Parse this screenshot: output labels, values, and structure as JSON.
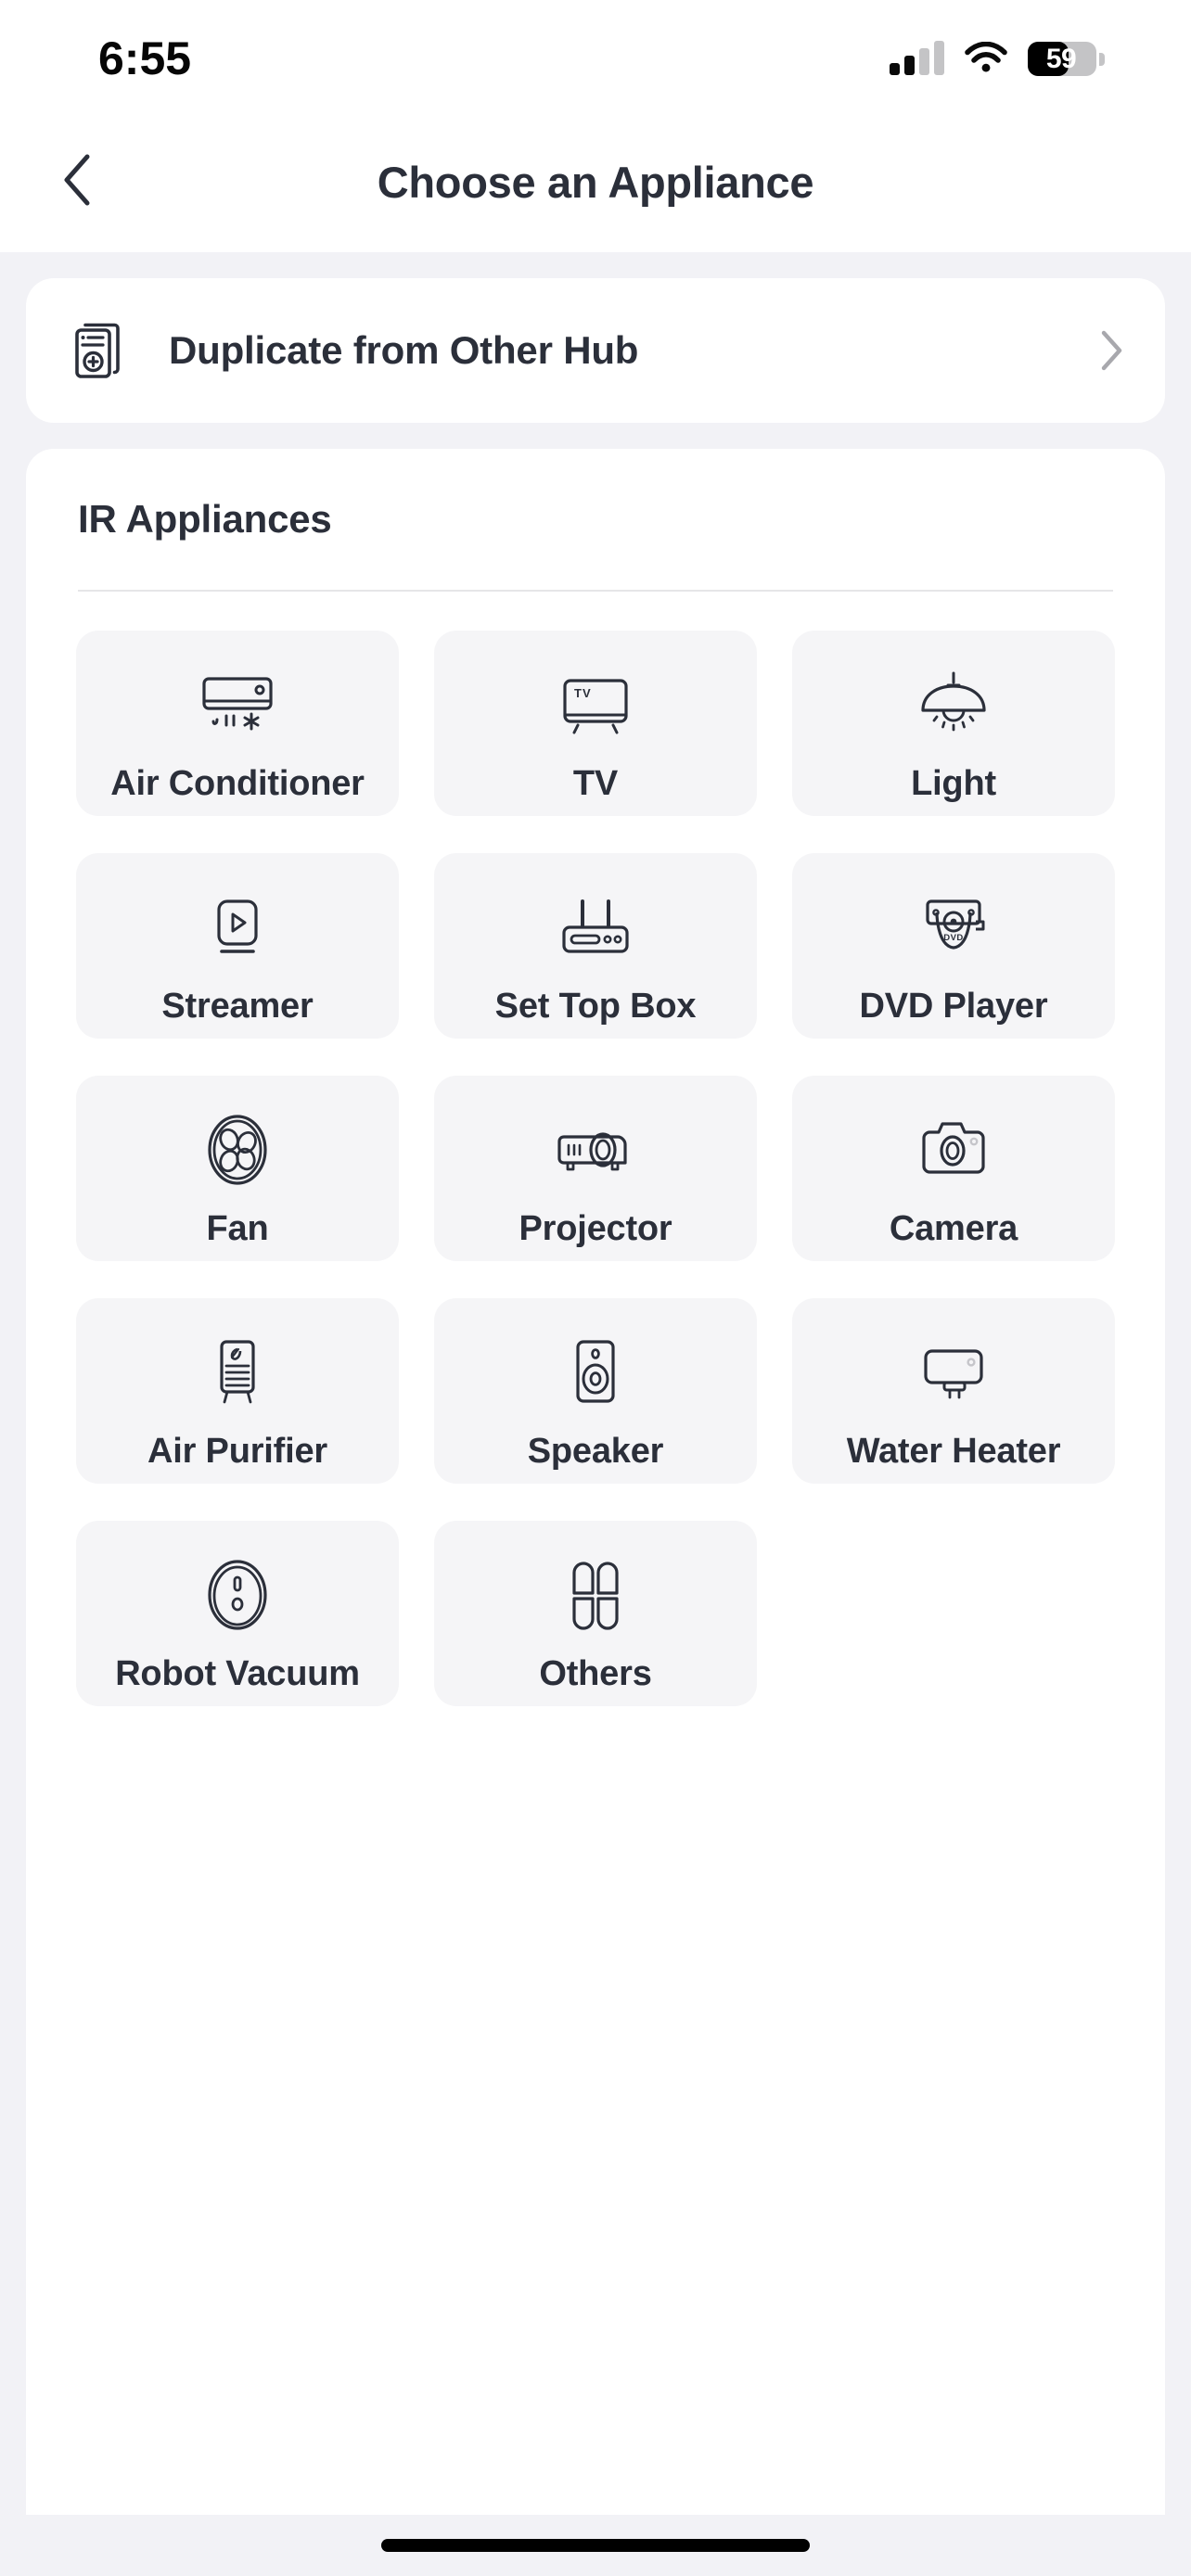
{
  "status_bar": {
    "time": "6:55",
    "battery_percent": "59",
    "battery_level": 59,
    "signal_icon": "cellular-signal-icon",
    "wifi_icon": "wifi-icon",
    "battery_icon": "battery-icon"
  },
  "nav": {
    "back_icon": "chevron-left-icon",
    "title": "Choose an Appliance"
  },
  "duplicate_row": {
    "icon": "duplicate-remote-icon",
    "label": "Duplicate from Other Hub",
    "chevron_icon": "chevron-right-icon"
  },
  "appliances_section": {
    "title": "IR Appliances",
    "tiles": [
      {
        "label": "Air Conditioner",
        "icon": "air-conditioner-icon"
      },
      {
        "label": "TV",
        "icon": "tv-icon"
      },
      {
        "label": "Light",
        "icon": "pendant-light-icon"
      },
      {
        "label": "Streamer",
        "icon": "streamer-icon"
      },
      {
        "label": "Set Top Box",
        "icon": "set-top-box-icon"
      },
      {
        "label": "DVD Player",
        "icon": "dvd-player-icon"
      },
      {
        "label": "Fan",
        "icon": "fan-icon"
      },
      {
        "label": "Projector",
        "icon": "projector-icon"
      },
      {
        "label": "Camera",
        "icon": "camera-icon"
      },
      {
        "label": "Air Purifier",
        "icon": "air-purifier-icon"
      },
      {
        "label": "Speaker",
        "icon": "speaker-icon"
      },
      {
        "label": "Water Heater",
        "icon": "water-heater-icon"
      },
      {
        "label": "Robot Vacuum",
        "icon": "robot-vacuum-icon"
      },
      {
        "label": "Others",
        "icon": "others-clover-icon"
      }
    ]
  },
  "colors": {
    "page_background": "#f2f2f6",
    "card_background": "#ffffff",
    "tile_background": "#f5f5f7",
    "text_primary": "#2b2f3a",
    "divider": "#e6e6e8",
    "chevron_gray": "#a8a8ad"
  },
  "home_indicator": {
    "icon": "home-indicator-bar"
  }
}
